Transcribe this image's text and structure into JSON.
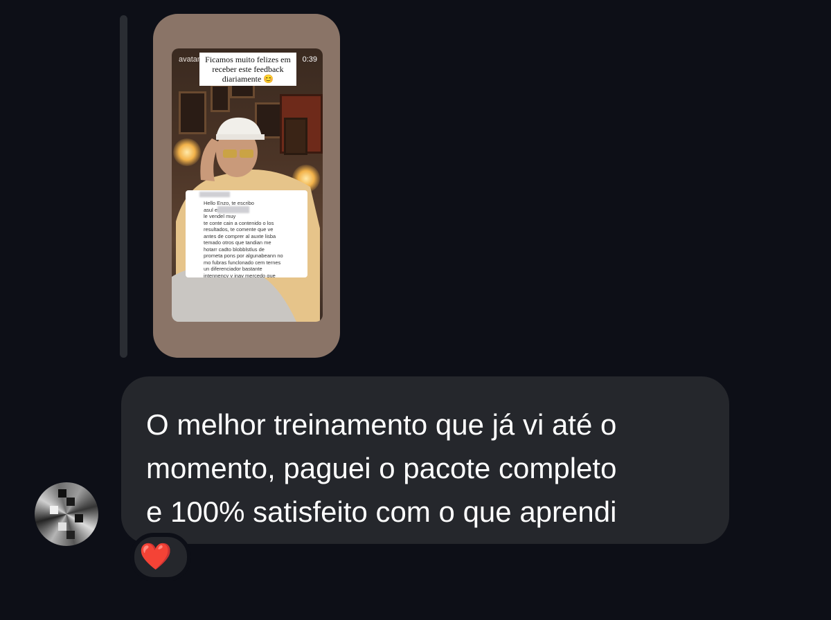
{
  "story": {
    "username": "avatan",
    "duration": "0:39",
    "caption": "Ficamos muito felizes em receber este feedback diariamente 😊",
    "feedback_text": "Hello Enzo, te escribo\nasul escriblando\nle vendel muy\nte conte cain a contenido o los\nresultados, te comente que ve\nantes de comprer al auxte lisba\ntemado otros que tandian me\nhotarr cadto blobblstlus de\nprometa pons por algunabeann no\nmo fubras funclonado cem ternes\nun diferenciador bastante\nintennency y inay mercedo que\nhace teda a difference como al"
  },
  "message": {
    "text": "O melhor treinamento que já vi até o\nmomento, paguei o pacote completo\ne 100% satisfeito com o que aprendi"
  },
  "reaction": {
    "emoji": "❤️"
  },
  "colors": {
    "background": "#0d0f17",
    "bubble": "#25272c",
    "story_frame": "#8a7467",
    "heart": "#e0242b"
  }
}
